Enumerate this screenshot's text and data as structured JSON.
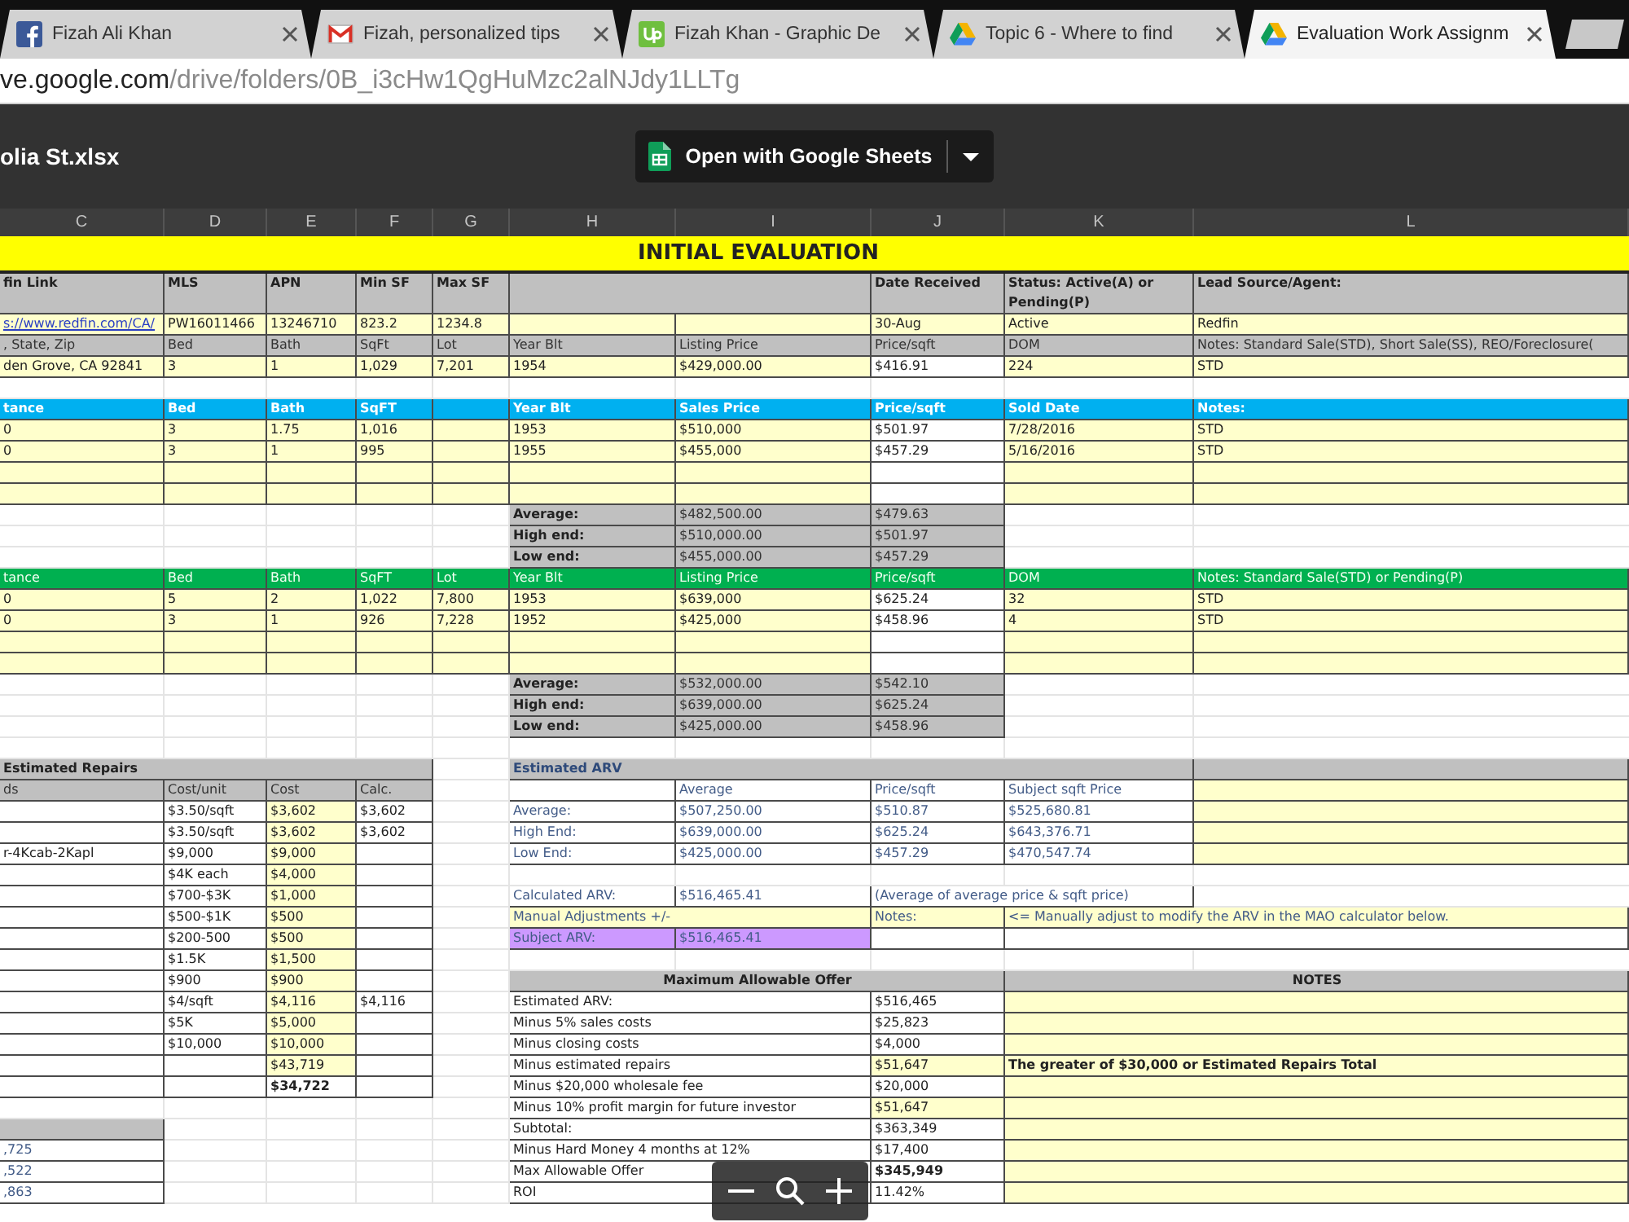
{
  "tabs": [
    {
      "kind": "facebook",
      "title": "Fizah Ali Khan",
      "selected": false
    },
    {
      "kind": "gmail",
      "title": "Fizah, personalized tips",
      "selected": false
    },
    {
      "kind": "upwork",
      "title": "Fizah Khan - Graphic De",
      "selected": false
    },
    {
      "kind": "drive",
      "title": "Topic 6 - Where to find",
      "selected": false
    },
    {
      "kind": "drive",
      "title": "Evaluation Work Assignm",
      "selected": true
    }
  ],
  "url": {
    "host": "ve.google.com",
    "path": "/drive/folders/0B_i3cHw1QgHuMzc2alNJdy1LLTg"
  },
  "viewer": {
    "file_name": "olia St.xlsx",
    "open_button": "Open with Google Sheets"
  },
  "sheet": {
    "columns": [
      "C",
      "D",
      "E",
      "F",
      "G",
      "H",
      "I",
      "J",
      "K",
      "L"
    ],
    "rows": [
      [
        {
          "kind": "band"
        },
        null,
        null,
        null,
        null,
        {
          "kind": "title",
          "text": "INITIAL EVALUATION"
        },
        null,
        null,
        {
          "kind": "band"
        },
        null
      ],
      [
        {
          "kind": "head",
          "text": "fin Link"
        },
        {
          "kind": "head",
          "text": "MLS"
        },
        {
          "kind": "head",
          "text": "APN"
        },
        {
          "kind": "head",
          "text": "Min SF"
        },
        {
          "kind": "head",
          "text": "Max SF"
        },
        {
          "kind": "head"
        },
        null,
        {
          "kind": "head",
          "text": "Date Received"
        },
        {
          "kind": "head",
          "text": "Status: Active(A) or Pending(P)"
        },
        {
          "kind": "head",
          "text": "Lead Source/Agent:"
        }
      ],
      [
        {
          "kind": "link",
          "text": "s://www.redfin.com/CA/"
        },
        {
          "kind": "input",
          "text": "PW16011466"
        },
        {
          "kind": "input",
          "text": "13246710"
        },
        {
          "kind": "input",
          "text": "823.2"
        },
        {
          "kind": "input",
          "text": "1234.8"
        },
        {
          "kind": "input"
        },
        {
          "kind": "input"
        },
        {
          "kind": "input",
          "text": "30-Aug"
        },
        {
          "kind": "input",
          "text": "Active"
        },
        {
          "kind": "input",
          "text": "Redfin"
        }
      ],
      [
        {
          "kind": "label",
          "text": ", State, Zip"
        },
        {
          "kind": "label",
          "text": "Bed"
        },
        {
          "kind": "label",
          "text": "Bath"
        },
        {
          "kind": "label",
          "text": "SqFt"
        },
        {
          "kind": "label",
          "text": "Lot"
        },
        {
          "kind": "label",
          "text": "Year Blt"
        },
        {
          "kind": "label",
          "text": "Listing Price"
        },
        {
          "kind": "label",
          "text": "Price/sqft"
        },
        {
          "kind": "label",
          "text": "DOM"
        },
        {
          "kind": "label",
          "text": "Notes: Standard Sale(STD), Short Sale(SS), REO/Foreclosure("
        }
      ],
      [
        {
          "kind": "input",
          "text": "den Grove, CA 92841"
        },
        {
          "kind": "input",
          "text": "3"
        },
        {
          "kind": "input",
          "text": "1"
        },
        {
          "kind": "input",
          "text": "1,029"
        },
        {
          "kind": "input",
          "text": "7,201"
        },
        {
          "kind": "input",
          "text": "1954"
        },
        {
          "kind": "input",
          "text": "$429,000.00"
        },
        {
          "kind": "output",
          "text": "$416.91"
        },
        {
          "kind": "input",
          "text": "224"
        },
        {
          "kind": "input",
          "text": "STD"
        }
      ],
      [
        {
          "kind": "blank"
        },
        {
          "kind": "blank"
        },
        {
          "kind": "blank"
        },
        {
          "kind": "blank"
        },
        {
          "kind": "blank"
        },
        {
          "kind": "blank"
        },
        {
          "kind": "blank"
        },
        {
          "kind": "blank"
        },
        {
          "kind": "blank"
        },
        {
          "kind": "blank"
        }
      ],
      [
        {
          "kind": "sold",
          "text": "tance"
        },
        {
          "kind": "sold",
          "text": "Bed"
        },
        {
          "kind": "sold",
          "text": "Bath"
        },
        {
          "kind": "sold",
          "text": "SqFT"
        },
        {
          "kind": "sold"
        },
        {
          "kind": "sold",
          "text": "Year Blt"
        },
        {
          "kind": "sold",
          "text": "Sales Price"
        },
        {
          "kind": "sold",
          "text": "Price/sqft"
        },
        {
          "kind": "sold",
          "text": "Sold Date"
        },
        {
          "kind": "sold",
          "text": "Notes:"
        }
      ],
      [
        {
          "kind": "input",
          "text": "0"
        },
        {
          "kind": "input",
          "text": "3"
        },
        {
          "kind": "input",
          "text": "1.75"
        },
        {
          "kind": "input",
          "text": "1,016"
        },
        {
          "kind": "input"
        },
        {
          "kind": "input",
          "text": "1953"
        },
        {
          "kind": "input",
          "text": "$510,000"
        },
        {
          "kind": "output",
          "text": "$501.97"
        },
        {
          "kind": "input",
          "text": "7/28/2016"
        },
        {
          "kind": "input",
          "text": "STD"
        }
      ],
      [
        {
          "kind": "input",
          "text": "0"
        },
        {
          "kind": "input",
          "text": "3"
        },
        {
          "kind": "input",
          "text": "1"
        },
        {
          "kind": "input",
          "text": "995"
        },
        {
          "kind": "input"
        },
        {
          "kind": "input",
          "text": "1955"
        },
        {
          "kind": "input",
          "text": "$455,000"
        },
        {
          "kind": "output",
          "text": "$457.29"
        },
        {
          "kind": "input",
          "text": "5/16/2016"
        },
        {
          "kind": "input",
          "text": "STD"
        }
      ],
      [
        {
          "kind": "input"
        },
        {
          "kind": "input"
        },
        {
          "kind": "input"
        },
        {
          "kind": "input"
        },
        {
          "kind": "input"
        },
        {
          "kind": "input"
        },
        {
          "kind": "input"
        },
        {
          "kind": "output"
        },
        {
          "kind": "input"
        },
        {
          "kind": "input"
        }
      ],
      [
        {
          "kind": "input"
        },
        {
          "kind": "input"
        },
        {
          "kind": "input"
        },
        {
          "kind": "input"
        },
        {
          "kind": "input"
        },
        {
          "kind": "input"
        },
        {
          "kind": "input"
        },
        {
          "kind": "output"
        },
        {
          "kind": "input"
        },
        {
          "kind": "input"
        }
      ],
      [
        {
          "kind": "blank"
        },
        {
          "kind": "blank"
        },
        {
          "kind": "blank"
        },
        {
          "kind": "blank"
        },
        {
          "kind": "blank"
        },
        {
          "kind": "head",
          "text": "Average:"
        },
        {
          "kind": "label",
          "text": "$482,500.00"
        },
        {
          "kind": "label",
          "text": "$479.63"
        },
        {
          "kind": "blank"
        },
        {
          "kind": "blank"
        }
      ],
      [
        {
          "kind": "blank"
        },
        {
          "kind": "blank"
        },
        {
          "kind": "blank"
        },
        {
          "kind": "blank"
        },
        {
          "kind": "blank"
        },
        {
          "kind": "head",
          "text": "High end:"
        },
        {
          "kind": "label",
          "text": "$510,000.00"
        },
        {
          "kind": "label",
          "text": "$501.97"
        },
        {
          "kind": "blank"
        },
        {
          "kind": "blank"
        }
      ],
      [
        {
          "kind": "blank"
        },
        {
          "kind": "blank"
        },
        {
          "kind": "blank"
        },
        {
          "kind": "blank"
        },
        {
          "kind": "blank"
        },
        {
          "kind": "head",
          "text": "Low end:"
        },
        {
          "kind": "label",
          "text": "$455,000.00"
        },
        {
          "kind": "label",
          "text": "$457.29"
        },
        {
          "kind": "blank"
        },
        {
          "kind": "blank"
        }
      ],
      [
        {
          "kind": "active",
          "text": "tance"
        },
        {
          "kind": "active",
          "text": "Bed"
        },
        {
          "kind": "active",
          "text": "Bath"
        },
        {
          "kind": "active",
          "text": "SqFT"
        },
        {
          "kind": "active",
          "text": "Lot"
        },
        {
          "kind": "active",
          "text": "Year Blt"
        },
        {
          "kind": "active",
          "text": "Listing Price"
        },
        {
          "kind": "active",
          "text": "Price/sqft"
        },
        {
          "kind": "active",
          "text": "DOM"
        },
        {
          "kind": "active",
          "text": "Notes: Standard Sale(STD) or Pending(P)"
        }
      ],
      [
        {
          "kind": "input",
          "text": "0"
        },
        {
          "kind": "input",
          "text": "5"
        },
        {
          "kind": "input",
          "text": "2"
        },
        {
          "kind": "input",
          "text": "1,022"
        },
        {
          "kind": "input",
          "text": "7,800"
        },
        {
          "kind": "input",
          "text": "1953"
        },
        {
          "kind": "input",
          "text": "$639,000"
        },
        {
          "kind": "output",
          "text": "$625.24"
        },
        {
          "kind": "input",
          "text": "32"
        },
        {
          "kind": "input",
          "text": "STD"
        }
      ],
      [
        {
          "kind": "input",
          "text": "0"
        },
        {
          "kind": "input",
          "text": "3"
        },
        {
          "kind": "input",
          "text": "1"
        },
        {
          "kind": "input",
          "text": "926"
        },
        {
          "kind": "input",
          "text": "7,228"
        },
        {
          "kind": "input",
          "text": "1952"
        },
        {
          "kind": "input",
          "text": "$425,000"
        },
        {
          "kind": "output",
          "text": "$458.96"
        },
        {
          "kind": "input",
          "text": "4"
        },
        {
          "kind": "input",
          "text": "STD"
        }
      ],
      [
        {
          "kind": "input"
        },
        {
          "kind": "input"
        },
        {
          "kind": "input"
        },
        {
          "kind": "input"
        },
        {
          "kind": "input"
        },
        {
          "kind": "input"
        },
        {
          "kind": "input"
        },
        {
          "kind": "output"
        },
        {
          "kind": "input"
        },
        {
          "kind": "input"
        }
      ],
      [
        {
          "kind": "input"
        },
        {
          "kind": "input"
        },
        {
          "kind": "input"
        },
        {
          "kind": "input"
        },
        {
          "kind": "input"
        },
        {
          "kind": "input"
        },
        {
          "kind": "input"
        },
        {
          "kind": "output"
        },
        {
          "kind": "input"
        },
        {
          "kind": "input"
        }
      ],
      [
        {
          "kind": "blank"
        },
        {
          "kind": "blank"
        },
        {
          "kind": "blank"
        },
        {
          "kind": "blank"
        },
        {
          "kind": "blank"
        },
        {
          "kind": "head",
          "text": "Average:"
        },
        {
          "kind": "label",
          "text": "$532,000.00"
        },
        {
          "kind": "label",
          "text": "$542.10"
        },
        {
          "kind": "blank"
        },
        {
          "kind": "blank"
        }
      ],
      [
        {
          "kind": "blank"
        },
        {
          "kind": "blank"
        },
        {
          "kind": "blank"
        },
        {
          "kind": "blank"
        },
        {
          "kind": "blank"
        },
        {
          "kind": "head",
          "text": "High end:"
        },
        {
          "kind": "label",
          "text": "$639,000.00"
        },
        {
          "kind": "label",
          "text": "$625.24"
        },
        {
          "kind": "blank"
        },
        {
          "kind": "blank"
        }
      ],
      [
        {
          "kind": "blank"
        },
        {
          "kind": "blank"
        },
        {
          "kind": "blank"
        },
        {
          "kind": "blank"
        },
        {
          "kind": "blank"
        },
        {
          "kind": "head",
          "text": "Low end:"
        },
        {
          "kind": "label",
          "text": "$425,000.00"
        },
        {
          "kind": "label",
          "text": "$458.96"
        },
        {
          "kind": "blank"
        },
        {
          "kind": "blank"
        }
      ],
      [
        {
          "kind": "blank"
        },
        {
          "kind": "blank"
        },
        {
          "kind": "blank"
        },
        {
          "kind": "blank"
        },
        {
          "kind": "blank"
        },
        {
          "kind": "blank"
        },
        {
          "kind": "blank"
        },
        {
          "kind": "blank"
        },
        {
          "kind": "blank"
        },
        {
          "kind": "blank"
        }
      ],
      [
        {
          "kind": "head",
          "text": "Estimated Repairs"
        },
        null,
        null,
        null,
        {
          "kind": "blank"
        },
        {
          "kind": "arvhead",
          "text": "Estimated ARV"
        },
        null,
        null,
        null,
        {
          "kind": "head"
        }
      ],
      [
        {
          "kind": "label",
          "text": "ds"
        },
        {
          "kind": "label",
          "text": "Cost/unit"
        },
        {
          "kind": "label",
          "text": "Cost"
        },
        {
          "kind": "label",
          "text": "Calc."
        },
        {
          "kind": "blank"
        },
        {
          "kind": "arv"
        },
        {
          "kind": "arv",
          "text": "Average"
        },
        {
          "kind": "arv",
          "text": "Price/sqft"
        },
        {
          "kind": "arv",
          "text": "Subject sqft Price"
        },
        {
          "kind": "input"
        }
      ],
      [
        {
          "kind": "output"
        },
        {
          "kind": "output",
          "text": "$3.50/sqft"
        },
        {
          "kind": "input",
          "text": "$3,602"
        },
        {
          "kind": "output",
          "text": "$3,602"
        },
        {
          "kind": "blank"
        },
        {
          "kind": "arv",
          "text": "Average:"
        },
        {
          "kind": "arv",
          "text": "$507,250.00"
        },
        {
          "kind": "arv",
          "text": "$510.87"
        },
        {
          "kind": "arv",
          "text": "$525,680.81"
        },
        {
          "kind": "input"
        }
      ],
      [
        {
          "kind": "output"
        },
        {
          "kind": "output",
          "text": "$3.50/sqft"
        },
        {
          "kind": "input",
          "text": "$3,602"
        },
        {
          "kind": "output",
          "text": "$3,602"
        },
        {
          "kind": "blank"
        },
        {
          "kind": "arv",
          "text": "High End:"
        },
        {
          "kind": "arv",
          "text": "$639,000.00"
        },
        {
          "kind": "arv",
          "text": "$625.24"
        },
        {
          "kind": "arv",
          "text": "$643,376.71"
        },
        {
          "kind": "input"
        }
      ],
      [
        {
          "kind": "output",
          "text": "r-4Kcab-2Kapl"
        },
        {
          "kind": "output",
          "text": "$9,000"
        },
        {
          "kind": "input",
          "text": "$9,000"
        },
        {
          "kind": "output"
        },
        {
          "kind": "blank"
        },
        {
          "kind": "arv",
          "text": "Low End:"
        },
        {
          "kind": "arv",
          "text": "$425,000.00"
        },
        {
          "kind": "arv",
          "text": "$457.29"
        },
        {
          "kind": "arv",
          "text": "$470,547.74"
        },
        {
          "kind": "input"
        }
      ],
      [
        {
          "kind": "output"
        },
        {
          "kind": "output",
          "text": "$4K each"
        },
        {
          "kind": "input",
          "text": "$4,000"
        },
        {
          "kind": "output"
        },
        {
          "kind": "blank"
        },
        {
          "kind": "blank"
        },
        {
          "kind": "blank"
        },
        {
          "kind": "blank"
        },
        {
          "kind": "blank"
        },
        {
          "kind": "blank"
        }
      ],
      [
        {
          "kind": "output"
        },
        {
          "kind": "output",
          "text": "$700-$3K"
        },
        {
          "kind": "input",
          "text": "$1,000"
        },
        {
          "kind": "output"
        },
        {
          "kind": "blank"
        },
        {
          "kind": "arv",
          "text": "Calculated ARV:"
        },
        {
          "kind": "arv",
          "text": "$516,465.41"
        },
        {
          "kind": "arv",
          "text": "(Average of average price & sqft price)"
        },
        null,
        {
          "kind": "blank"
        }
      ],
      [
        {
          "kind": "output"
        },
        {
          "kind": "output",
          "text": "$500-$1K"
        },
        {
          "kind": "input",
          "text": "$500"
        },
        {
          "kind": "output"
        },
        {
          "kind": "blank"
        },
        {
          "kind": "arvinput",
          "text": "Manual Adjustments +/-"
        },
        null,
        {
          "kind": "arvinput",
          "text": "Notes:"
        },
        {
          "kind": "arvinput",
          "text": "<= Manually adjust to modify the ARV in the MAO calculator below."
        },
        null
      ],
      [
        {
          "kind": "output"
        },
        {
          "kind": "output",
          "text": "$200-500"
        },
        {
          "kind": "input",
          "text": "$500"
        },
        {
          "kind": "output"
        },
        {
          "kind": "blank"
        },
        {
          "kind": "subject",
          "text": "Subject ARV:"
        },
        {
          "kind": "subject",
          "text": "$516,465.41"
        },
        {
          "kind": "arv"
        },
        {
          "kind": "arv"
        },
        null
      ],
      [
        {
          "kind": "output"
        },
        {
          "kind": "output",
          "text": "$1.5K"
        },
        {
          "kind": "input",
          "text": "$1,500"
        },
        {
          "kind": "output"
        },
        {
          "kind": "blank"
        },
        {
          "kind": "blank"
        },
        {
          "kind": "blank"
        },
        {
          "kind": "blank"
        },
        {
          "kind": "blank"
        },
        {
          "kind": "blank"
        }
      ],
      [
        {
          "kind": "output"
        },
        {
          "kind": "output",
          "text": "$900"
        },
        {
          "kind": "input",
          "text": "$900"
        },
        {
          "kind": "output"
        },
        {
          "kind": "blank"
        },
        {
          "kind": "section",
          "text": "Maximum Allowable Offer"
        },
        null,
        null,
        {
          "kind": "section",
          "text": "NOTES"
        },
        null
      ],
      [
        {
          "kind": "output"
        },
        {
          "kind": "output",
          "text": "$4/sqft"
        },
        {
          "kind": "input",
          "text": "$4,116"
        },
        {
          "kind": "output",
          "text": "$4,116"
        },
        {
          "kind": "blank"
        },
        {
          "kind": "output",
          "text": "Estimated ARV:"
        },
        null,
        {
          "kind": "output",
          "text": "$516,465"
        },
        {
          "kind": "input"
        },
        null
      ],
      [
        {
          "kind": "output"
        },
        {
          "kind": "output",
          "text": "$5K"
        },
        {
          "kind": "input",
          "text": "$5,000"
        },
        {
          "kind": "output"
        },
        {
          "kind": "blank"
        },
        {
          "kind": "output",
          "text": "Minus 5% sales costs"
        },
        null,
        {
          "kind": "output",
          "text": "$25,823"
        },
        {
          "kind": "input"
        },
        null
      ],
      [
        {
          "kind": "output"
        },
        {
          "kind": "output",
          "text": "$10,000"
        },
        {
          "kind": "input",
          "text": "$10,000"
        },
        {
          "kind": "output"
        },
        {
          "kind": "blank"
        },
        {
          "kind": "output",
          "text": "Minus closing costs"
        },
        null,
        {
          "kind": "output",
          "text": "$4,000"
        },
        {
          "kind": "input"
        },
        null
      ],
      [
        {
          "kind": "output"
        },
        {
          "kind": "output"
        },
        {
          "kind": "input",
          "text": "$43,719"
        },
        {
          "kind": "output"
        },
        {
          "kind": "blank"
        },
        {
          "kind": "output",
          "text": "Minus estimated repairs"
        },
        null,
        {
          "kind": "input",
          "text": "$51,647"
        },
        {
          "kind": "note",
          "text": "The greater of $30,000 or Estimated Repairs Total"
        },
        null
      ],
      [
        {
          "kind": "output"
        },
        {
          "kind": "output"
        },
        {
          "kind": "total",
          "text": "$34,722"
        },
        {
          "kind": "output"
        },
        {
          "kind": "blank"
        },
        {
          "kind": "output",
          "text": "Minus $20,000 wholesale fee"
        },
        null,
        {
          "kind": "output",
          "text": "$20,000"
        },
        {
          "kind": "input"
        },
        null
      ],
      [
        {
          "kind": "blank"
        },
        {
          "kind": "blank"
        },
        {
          "kind": "blank"
        },
        {
          "kind": "blank"
        },
        {
          "kind": "blank"
        },
        {
          "kind": "output",
          "text": "Minus 10% profit margin for future investor"
        },
        null,
        {
          "kind": "input",
          "text": "$51,647"
        },
        {
          "kind": "input"
        },
        null
      ],
      [
        {
          "kind": "head"
        },
        {
          "kind": "blank"
        },
        {
          "kind": "blank"
        },
        {
          "kind": "blank"
        },
        {
          "kind": "blank"
        },
        {
          "kind": "output",
          "text": "Subtotal:"
        },
        null,
        {
          "kind": "output",
          "text": "$363,349"
        },
        {
          "kind": "input"
        },
        null
      ],
      [
        {
          "kind": "arv",
          "text": ",725"
        },
        {
          "kind": "blank"
        },
        {
          "kind": "blank"
        },
        {
          "kind": "blank"
        },
        {
          "kind": "blank"
        },
        {
          "kind": "output",
          "text": "Minus Hard Money 4 months at 12%"
        },
        null,
        {
          "kind": "output",
          "text": "$17,400"
        },
        {
          "kind": "input"
        },
        null
      ],
      [
        {
          "kind": "arv",
          "text": ",522"
        },
        {
          "kind": "blank"
        },
        {
          "kind": "blank"
        },
        {
          "kind": "blank"
        },
        {
          "kind": "blank"
        },
        {
          "kind": "output",
          "text": "Max Allowable Offer"
        },
        null,
        {
          "kind": "total",
          "text": "$345,949"
        },
        {
          "kind": "input"
        },
        null
      ],
      [
        {
          "kind": "arv",
          "text": ",863"
        },
        {
          "kind": "blank"
        },
        {
          "kind": "blank"
        },
        {
          "kind": "blank"
        },
        {
          "kind": "blank"
        },
        {
          "kind": "output",
          "text": "ROI"
        },
        null,
        {
          "kind": "output",
          "text": "11.42%"
        },
        {
          "kind": "input"
        },
        null
      ]
    ]
  }
}
